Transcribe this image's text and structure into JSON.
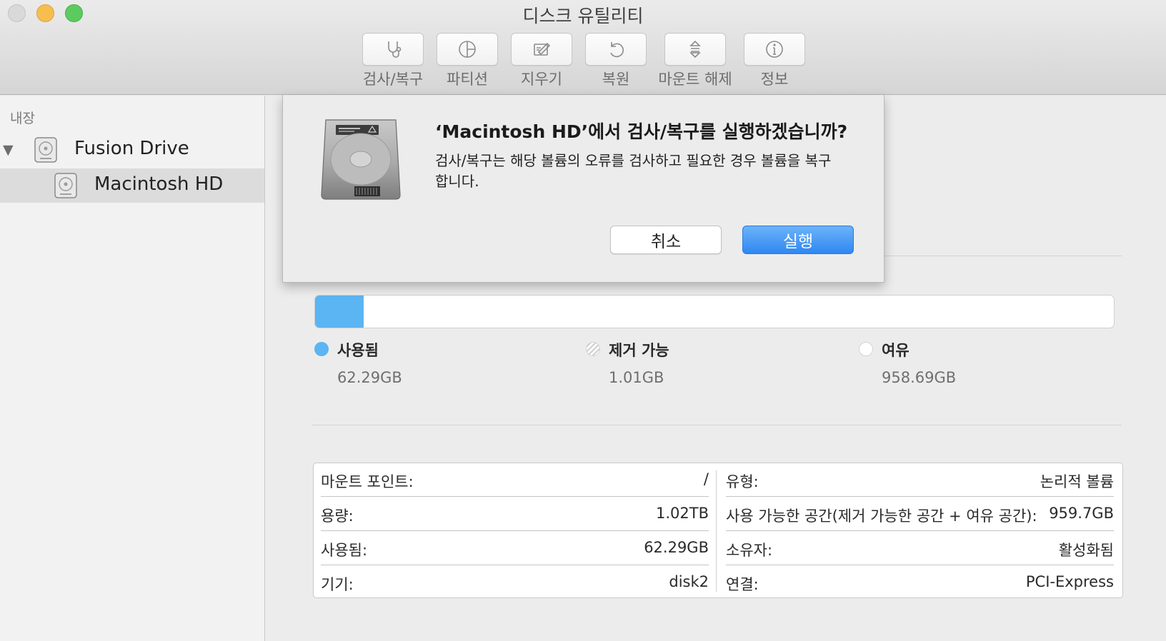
{
  "window": {
    "title": "디스크 유틸리티"
  },
  "toolbar": {
    "buttons": [
      {
        "label": "검사/복구",
        "icon": "stethoscope-icon"
      },
      {
        "label": "파티션",
        "icon": "pie-chart-icon"
      },
      {
        "label": "지우기",
        "icon": "eraser-icon"
      },
      {
        "label": "복원",
        "icon": "restore-arrow-icon"
      },
      {
        "label": "마운트 해제",
        "icon": "eject-icon"
      },
      {
        "label": "정보",
        "icon": "info-icon"
      }
    ]
  },
  "sidebar": {
    "section": "내장",
    "items": [
      {
        "label": "Fusion Drive",
        "icon": "hard-disk-icon",
        "expanded": true
      },
      {
        "label": "Macintosh HD",
        "icon": "volume-icon",
        "selected": true
      }
    ]
  },
  "dialog": {
    "title": "‘Macintosh HD’에서 검사/복구를 실행하겠습니까?",
    "message": "검사/복구는 해당 볼륨의 오류를 검사하고 필요한 경우 볼륨을 복구합니다.",
    "cancel_label": "취소",
    "run_label": "실행",
    "icon": "hard-drive-icon"
  },
  "usage": {
    "used_fraction": 0.0609,
    "legend": [
      {
        "label": "사용됨",
        "value": "62.29GB",
        "color": "#5ab5f2"
      },
      {
        "label": "제거 가능",
        "value": "1.01GB",
        "color": "#ffffff"
      },
      {
        "label": "여유",
        "value": "958.69GB",
        "color": "#ffffff"
      }
    ]
  },
  "info": {
    "left": [
      {
        "key": "마운트 포인트:",
        "value": "/"
      },
      {
        "key": "용량:",
        "value": "1.02TB"
      },
      {
        "key": "사용됨:",
        "value": "62.29GB"
      },
      {
        "key": "기기:",
        "value": "disk2"
      }
    ],
    "right": [
      {
        "key": "유형:",
        "value": "논리적 볼륨"
      },
      {
        "key": "사용 가능한 공간(제거 가능한 공간 + 여유 공간):",
        "value": "959.7GB"
      },
      {
        "key": "소유자:",
        "value": "활성화됨"
      },
      {
        "key": "연결:",
        "value": "PCI-Express"
      }
    ]
  },
  "colors": {
    "accent": "#2f87f1",
    "used": "#5ab5f2"
  }
}
